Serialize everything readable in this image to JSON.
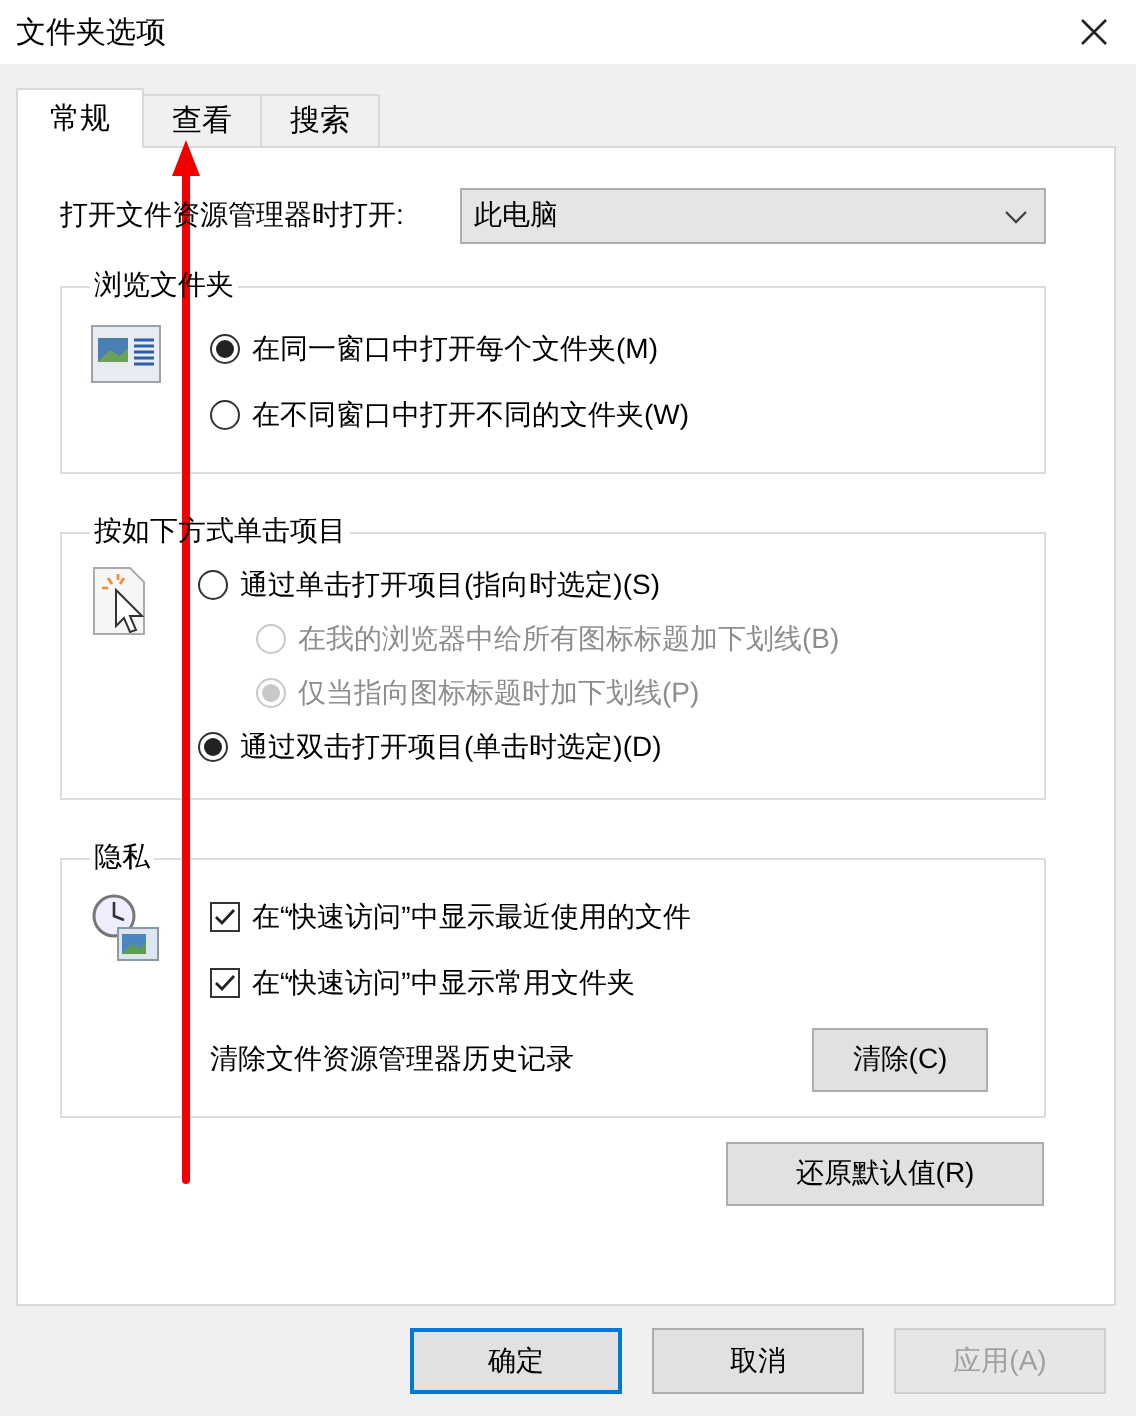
{
  "window": {
    "title": "文件夹选项"
  },
  "tabs": [
    {
      "label": "常规",
      "selected": true
    },
    {
      "label": "查看",
      "selected": false
    },
    {
      "label": "搜索",
      "selected": false
    }
  ],
  "open_in": {
    "label": "打开文件资源管理器时打开:",
    "value": "此电脑"
  },
  "browse_folders": {
    "title": "浏览文件夹",
    "options": [
      {
        "label": "在同一窗口中打开每个文件夹(M)",
        "selected": true,
        "disabled": false
      },
      {
        "label": "在不同窗口中打开不同的文件夹(W)",
        "selected": false,
        "disabled": false
      }
    ]
  },
  "click_items": {
    "title": "按如下方式单击项目",
    "options": [
      {
        "label": "通过单击打开项目(指向时选定)(S)",
        "selected": false,
        "disabled": false,
        "children": [
          {
            "label": "在我的浏览器中给所有图标标题加下划线(B)",
            "selected": false,
            "disabled": true
          },
          {
            "label": "仅当指向图标标题时加下划线(P)",
            "selected": true,
            "disabled": true
          }
        ]
      },
      {
        "label": "通过双击打开项目(单击时选定)(D)",
        "selected": true,
        "disabled": false
      }
    ]
  },
  "privacy": {
    "title": "隐私",
    "checkboxes": [
      {
        "label": "在“快速访问”中显示最近使用的文件",
        "checked": true
      },
      {
        "label": "在“快速访问”中显示常用文件夹",
        "checked": true
      }
    ],
    "clear_label": "清除文件资源管理器历史记录",
    "clear_button": "清除(C)"
  },
  "restore_button": "还原默认值(R)",
  "buttons": [
    {
      "label": "确定",
      "default": true,
      "disabled": false
    },
    {
      "label": "取消",
      "default": false,
      "disabled": false
    },
    {
      "label": "应用(A)",
      "default": false,
      "disabled": true
    }
  ]
}
